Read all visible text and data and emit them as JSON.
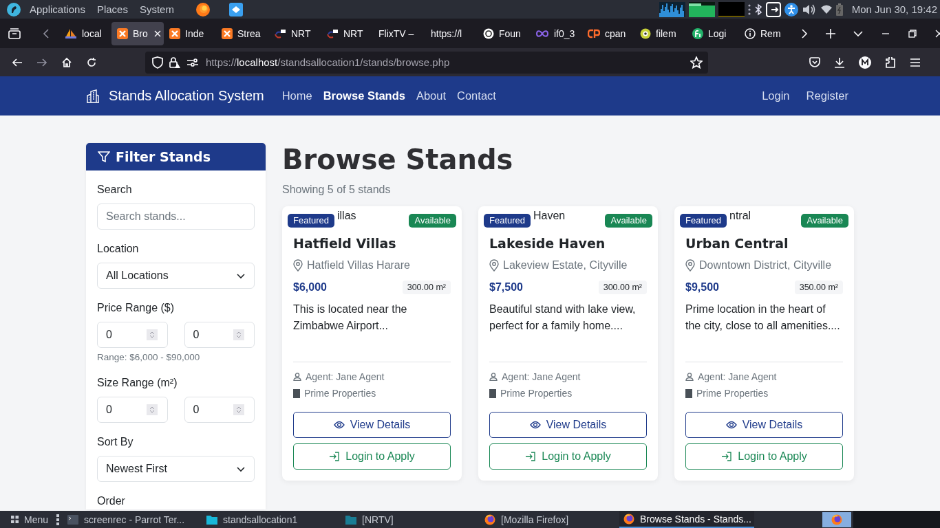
{
  "desktop_panel": {
    "menus": [
      "Applications",
      "Places",
      "System"
    ],
    "clock": "Mon Jun 30, 19:42"
  },
  "browser": {
    "tabs": [
      {
        "label": "local",
        "kind": "pma",
        "selected": false
      },
      {
        "label": "Bro",
        "kind": "xampp",
        "selected": true
      },
      {
        "label": "Inde",
        "kind": "xampp",
        "selected": false
      },
      {
        "label": "Strea",
        "kind": "xampp",
        "selected": false
      },
      {
        "label": "NRT",
        "kind": "nrtv",
        "selected": false
      },
      {
        "label": "NRT",
        "kind": "nrtv",
        "selected": false
      },
      {
        "label": "FlixTV –",
        "kind": "none",
        "selected": false
      },
      {
        "label": "https://l",
        "kind": "none",
        "selected": false
      },
      {
        "label": "Foun",
        "kind": "swirl",
        "selected": false
      },
      {
        "label": "if0_3",
        "kind": "infinity",
        "selected": false
      },
      {
        "label": "cpan",
        "kind": "cpanel",
        "selected": false
      },
      {
        "label": "filem",
        "kind": "monster",
        "selected": false
      },
      {
        "label": "Logi",
        "kind": "leaf",
        "selected": false
      },
      {
        "label": "Rem",
        "kind": "info",
        "selected": false
      }
    ],
    "url": {
      "scheme": "https://",
      "host": "localhost",
      "path": "/standsallocation1/stands/browse.php"
    }
  },
  "site": {
    "brand": "Stands Allocation System",
    "nav": [
      {
        "label": "Home",
        "selected": false
      },
      {
        "label": "Browse Stands",
        "selected": true
      },
      {
        "label": "About",
        "selected": false
      },
      {
        "label": "Contact",
        "selected": false
      }
    ],
    "account": [
      "Login",
      "Register"
    ]
  },
  "filters": {
    "title": "Filter Stands",
    "fields": [
      {
        "kind": "search",
        "label": "Search",
        "placeholder": "Search stands..."
      },
      {
        "kind": "select",
        "label": "Location",
        "value": "All Locations"
      },
      {
        "kind": "range",
        "label": "Price Range ($)",
        "min": "0",
        "max": "0",
        "hint": "Range: $6,000 - $90,000"
      },
      {
        "kind": "range",
        "label": "Size Range (m²)",
        "min": "0",
        "max": "0"
      },
      {
        "kind": "select",
        "label": "Sort By",
        "value": "Newest First"
      },
      {
        "kind": "heading",
        "label": "Order"
      }
    ]
  },
  "heading": "Browse Stands",
  "count": "Showing 5 of 5 stands",
  "stands": [
    {
      "image_alt": "illas",
      "tag": "Featured",
      "status": "Available",
      "title": "Hatfield Villas",
      "location": "Hatfield Villas Harare",
      "price": "$6,000",
      "size": "300.00 m²",
      "description": "This is located near the Zimbabwe Airport...",
      "agent": "Agent: Jane Agent",
      "company": "Prime Properties",
      "actions": [
        "View Details",
        "Login to Apply"
      ]
    },
    {
      "image_alt": "Haven",
      "tag": "Featured",
      "status": "Available",
      "title": "Lakeside Haven",
      "location": "Lakeview Estate, Cityville",
      "price": "$7,500",
      "size": "300.00 m²",
      "description": "Beautiful stand with lake view, perfect for a family home....",
      "agent": "Agent: Jane Agent",
      "company": "Prime Properties",
      "actions": [
        "View Details",
        "Login to Apply"
      ]
    },
    {
      "image_alt": "ntral",
      "tag": "Featured",
      "status": "Available",
      "title": "Urban Central",
      "location": "Downtown District, Cityville",
      "price": "$9,500",
      "size": "350.00 m²",
      "description": "Prime location in the heart of the city, close to all amenities....",
      "agent": "Agent: Jane Agent",
      "company": "Prime Properties",
      "actions": [
        "View Details",
        "Login to Apply"
      ]
    }
  ],
  "taskbar": {
    "menu": "Menu",
    "items": [
      {
        "label": "screenrec - Parrot Ter...",
        "kind": "terminal",
        "selected": false
      },
      {
        "label": "standsallocation1",
        "kind": "folder",
        "selected": false
      },
      {
        "label": "[NRTV]",
        "kind": "folder-dim",
        "selected": false
      },
      {
        "label": "[Mozilla Firefox]",
        "kind": "firefox",
        "selected": false
      },
      {
        "label": "Browse Stands - Stands...",
        "kind": "firefox",
        "selected": true
      }
    ]
  }
}
